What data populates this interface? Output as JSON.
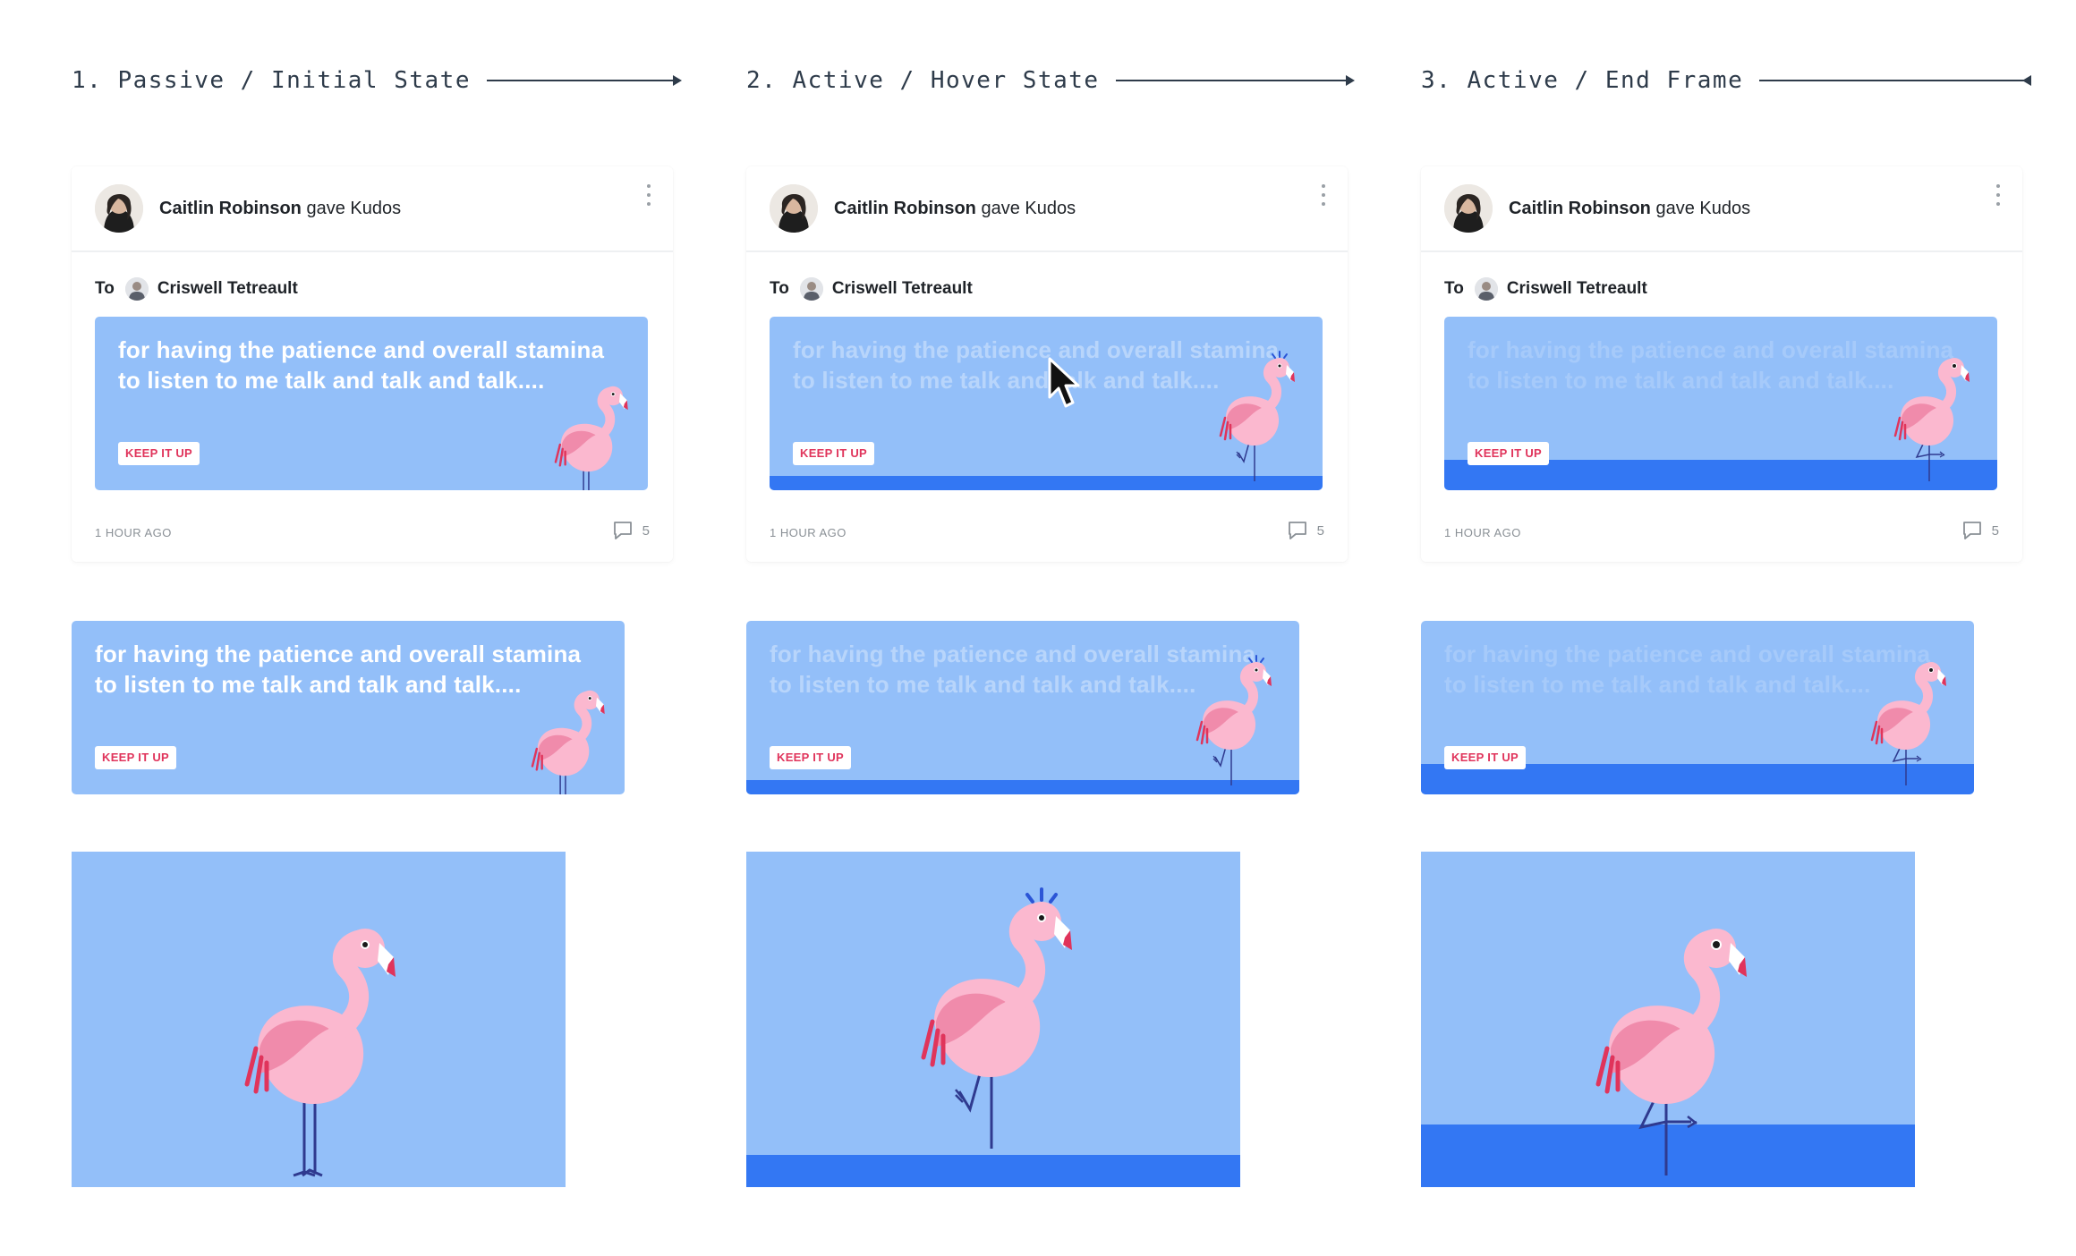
{
  "states": [
    {
      "title": "1. Passive / Initial State"
    },
    {
      "title": "2. Active / Hover State"
    },
    {
      "title": "3. Active / End Frame"
    }
  ],
  "post": {
    "giver_name": "Caitlin Robinson",
    "action": "gave Kudos",
    "to_label": "To",
    "recipient": "Criswell Tetreault",
    "timestamp": "1 HOUR AGO",
    "comment_count": "5"
  },
  "kudos": {
    "message": "for having the patience and overall stamina to listen to me talk and talk and talk....",
    "tag": "KEEP IT UP"
  },
  "colors": {
    "sky": "#93bff9",
    "water": "#3377f3",
    "flamingo_body": "#fbb8cf",
    "flamingo_wing": "#f08bab",
    "beak_tip": "#e0345b",
    "legs": "#2f3a8f",
    "tag_text": "#e0345b"
  },
  "icons": [
    "kebab-menu-icon",
    "comment-icon",
    "cursor-pointer-icon",
    "flamingo-illustration"
  ]
}
